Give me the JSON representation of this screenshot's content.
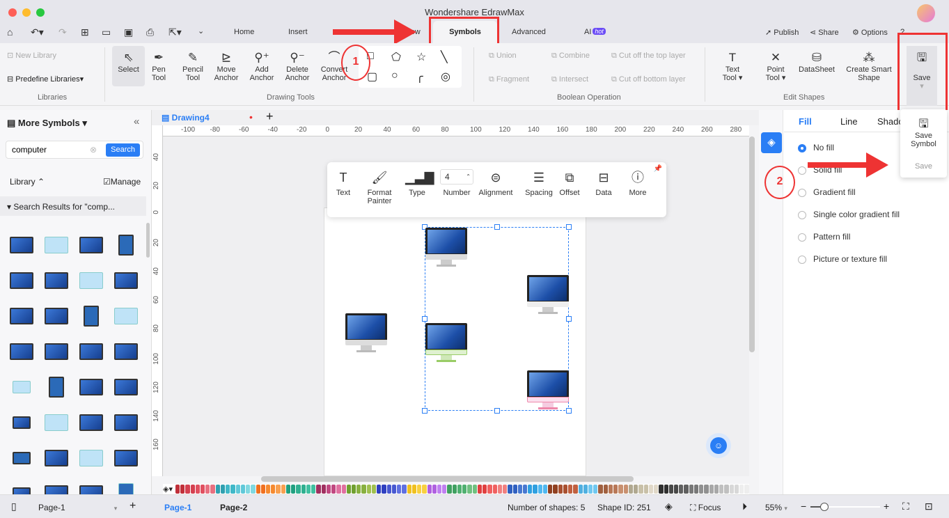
{
  "window": {
    "title": "Wondershare EdrawMax"
  },
  "menu_tabs": [
    "Home",
    "Insert",
    "Design",
    "View",
    "Symbols",
    "Advanced",
    "AI"
  ],
  "ai_badge": "hot",
  "header_actions": {
    "publish": "Publish",
    "share": "Share",
    "options": "Options"
  },
  "ribbon": {
    "libraries": {
      "new_library": "New Library",
      "predefine": "Predefine Libraries",
      "group": "Libraries"
    },
    "drawing_tools": {
      "group": "Drawing Tools",
      "select": "Select",
      "pen": [
        "Pen",
        "Tool"
      ],
      "pencil": [
        "Pencil",
        "Tool"
      ],
      "move_anchor": [
        "Move",
        "Anchor"
      ],
      "add_anchor": [
        "Add",
        "Anchor"
      ],
      "delete_anchor": [
        "Delete",
        "Anchor"
      ],
      "convert_anchor": [
        "Convert",
        "Anchor"
      ]
    },
    "boolean": {
      "group": "Boolean Operation",
      "union": "Union",
      "combine": "Combine",
      "cut_top": "Cut off the top layer",
      "fragment": "Fragment",
      "intersect": "Intersect",
      "cut_bottom": "Cut off bottom layer"
    },
    "edit_shapes": {
      "group": "Edit Shapes",
      "text_tool": [
        "Text",
        "Tool"
      ],
      "point_tool": [
        "Point",
        "Tool"
      ],
      "datasheet": "DataSheet",
      "smart_shape": [
        "Create Smart",
        "Shape"
      ]
    },
    "save": "Save"
  },
  "annotations": {
    "step1": "1",
    "step2": "2",
    "color": "#e33333"
  },
  "left_panel": {
    "title": "More Symbols",
    "search_value": "computer",
    "search_button": "Search",
    "library_label": "Library",
    "manage": "Manage",
    "results_label": "Search Results for  \"comp..."
  },
  "document": {
    "tab": "Drawing4"
  },
  "ruler_top": [
    "-100",
    "-80",
    "-60",
    "-40",
    "-20",
    "0",
    "20",
    "40",
    "60",
    "80",
    "100",
    "120",
    "140",
    "160",
    "180",
    "200",
    "220",
    "240",
    "260",
    "280"
  ],
  "ruler_left": [
    "40",
    "20",
    "0",
    "20",
    "40",
    "60",
    "80",
    "100",
    "120",
    "140",
    "160"
  ],
  "float_toolbar": {
    "text": "Text",
    "format_painter": [
      "Format",
      "Painter"
    ],
    "type": "Type",
    "number_value": "4",
    "number": "Number",
    "alignment": "Alignment",
    "spacing": "Spacing",
    "offset": "Offset",
    "data": "Data",
    "more": "More"
  },
  "right_panel": {
    "tabs": [
      "Fill",
      "Line",
      "Shadow"
    ],
    "fill_options": [
      "No fill",
      "Solid fill",
      "Gradient fill",
      "Single color gradient fill",
      "Pattern fill",
      "Picture or texture fill"
    ],
    "selected": "No fill"
  },
  "save_dropdown": {
    "save_symbol": [
      "Save",
      "Symbol"
    ],
    "save": "Save"
  },
  "status": {
    "page_select": "Page-1",
    "pages": [
      "Page-1",
      "Page-2"
    ],
    "shapes": "Number of shapes: 5",
    "shape_id": "Shape ID: 251",
    "focus": "Focus",
    "zoom": "55%"
  },
  "accent": "#2a7ef5",
  "palette": [
    "#c0303a",
    "#d44050",
    "#e05060",
    "#e87080",
    "#30a0b0",
    "#40b8c8",
    "#60c8d8",
    "#80d8e0",
    "#f07020",
    "#f58a30",
    "#f8a050",
    "#20a080",
    "#30b090",
    "#40c0a0",
    "#a03060",
    "#c04880",
    "#e070a0",
    "#70a030",
    "#88b040",
    "#a0c050",
    "#3040c0",
    "#4858d0",
    "#6070e0",
    "#f0c020",
    "#f8d040",
    "#b060e0",
    "#c080f0",
    "#40a060",
    "#50b070",
    "#70c080",
    "#e04040",
    "#f06060",
    "#f08080",
    "#3060c0",
    "#4878d0",
    "#30a0e0",
    "#50b8f0",
    "#904020",
    "#a85030",
    "#c06040",
    "#50b0e0",
    "#70c8f0",
    "#a06040",
    "#b87858",
    "#c89070",
    "#b0a890",
    "#c8c0a8",
    "#e0d8c8",
    "#303030",
    "#484848",
    "#606060",
    "#787878",
    "#909090",
    "#a8a8a8",
    "#c0c0c0",
    "#d8d8d8",
    "#eeeeee"
  ]
}
